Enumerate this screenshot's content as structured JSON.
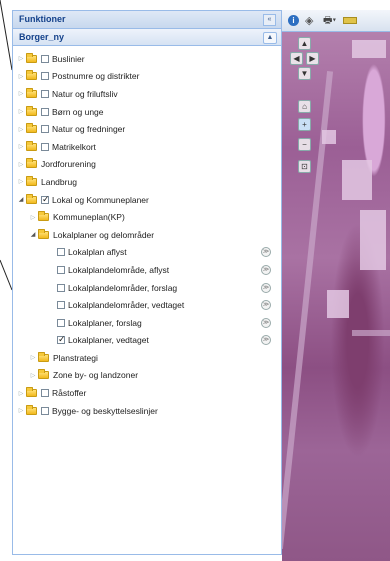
{
  "panel": {
    "title": "Funktioner",
    "subtitle": "Borger_ny",
    "collapse_icon": "«",
    "sub_collapse_icon": "▲"
  },
  "tree": [
    {
      "label": "Buslinier",
      "depth": 0,
      "folder": true,
      "checkbox": true,
      "checked": false,
      "expanded": false
    },
    {
      "label": "Postnumre og distrikter",
      "depth": 0,
      "folder": true,
      "checkbox": true,
      "checked": false,
      "expanded": false
    },
    {
      "label": "Natur og friluftsliv",
      "depth": 0,
      "folder": true,
      "checkbox": true,
      "checked": false,
      "expanded": false
    },
    {
      "label": "Børn og unge",
      "depth": 0,
      "folder": true,
      "checkbox": true,
      "checked": false,
      "expanded": false
    },
    {
      "label": "Natur og fredninger",
      "depth": 0,
      "folder": true,
      "checkbox": true,
      "checked": false,
      "expanded": false
    },
    {
      "label": "Matrikelkort",
      "depth": 0,
      "folder": true,
      "checkbox": true,
      "checked": false,
      "expanded": false
    },
    {
      "label": "Jordforurening",
      "depth": 0,
      "folder": true,
      "checkbox": false,
      "checked": false,
      "expanded": false
    },
    {
      "label": "Landbrug",
      "depth": 0,
      "folder": true,
      "checkbox": false,
      "checked": false,
      "expanded": false
    },
    {
      "label": "Lokal og Kommuneplaner",
      "depth": 0,
      "folder": true,
      "checkbox": true,
      "checked": true,
      "expanded": true
    },
    {
      "label": "Kommuneplan(KP)",
      "depth": 1,
      "folder": true,
      "checkbox": false,
      "checked": false,
      "expanded": false
    },
    {
      "label": "Lokalplaner og delområder",
      "depth": 1,
      "folder": true,
      "checkbox": false,
      "checked": false,
      "expanded": true
    },
    {
      "label": "Lokalplan aflyst",
      "depth": 2,
      "folder": false,
      "checkbox": true,
      "checked": false,
      "info": true
    },
    {
      "label": "Lokalplandelområde, aflyst",
      "depth": 2,
      "folder": false,
      "checkbox": true,
      "checked": false,
      "info": true
    },
    {
      "label": "Lokalplandelområder, forslag",
      "depth": 2,
      "folder": false,
      "checkbox": true,
      "checked": false,
      "info": true
    },
    {
      "label": "Lokalplandelområder, vedtaget",
      "depth": 2,
      "folder": false,
      "checkbox": true,
      "checked": false,
      "info": true
    },
    {
      "label": "Lokalplaner, forslag",
      "depth": 2,
      "folder": false,
      "checkbox": true,
      "checked": false,
      "info": true
    },
    {
      "label": "Lokalplaner, vedtaget",
      "depth": 2,
      "folder": false,
      "checkbox": true,
      "checked": true,
      "info": true
    },
    {
      "label": "Planstrategi",
      "depth": 1,
      "folder": true,
      "checkbox": false,
      "checked": false,
      "expanded": false
    },
    {
      "label": "Zone by- og landzoner",
      "depth": 1,
      "folder": true,
      "checkbox": false,
      "checked": false,
      "expanded": false
    },
    {
      "label": "Råstoffer",
      "depth": 0,
      "folder": true,
      "checkbox": true,
      "checked": false,
      "expanded": false
    },
    {
      "label": "Bygge- og beskyttelseslinjer",
      "depth": 0,
      "folder": true,
      "checkbox": true,
      "checked": false,
      "expanded": false
    }
  ],
  "map_toolbar": {
    "icons": [
      "info-icon",
      "layers-icon",
      "print-icon",
      "measure-icon"
    ],
    "info_glyph": "i",
    "layers_glyph": "◈",
    "print_glyph": "🖶▾"
  },
  "map_controls": {
    "pan_up": "▲",
    "pan_left": "◀",
    "pan_right": "▶",
    "pan_down": "▼",
    "home": "⌂",
    "zoom_in": "+",
    "zoom_out": "−"
  },
  "colors": {
    "header_text": "#15428b",
    "panel_border": "#99bbe8",
    "map_tint": "#9b5f95"
  }
}
